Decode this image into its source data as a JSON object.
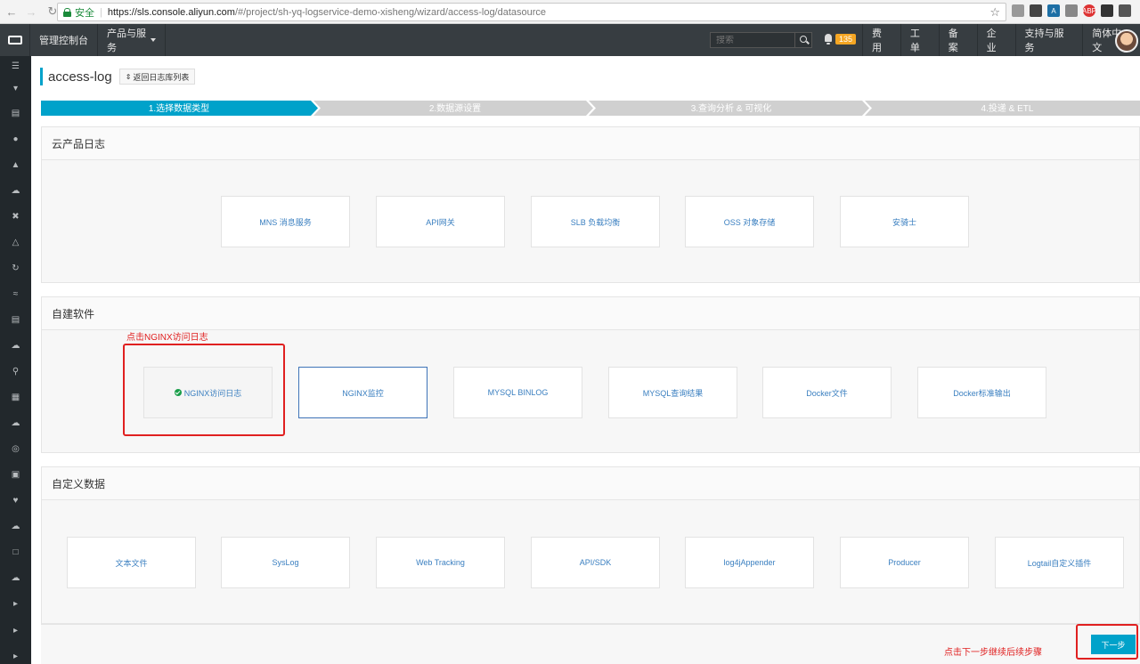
{
  "browser": {
    "secure_label": "安全",
    "url_host": "https://sls.console.aliyun.com",
    "url_path": "/#/project/sh-yq-logservice-demo-xisheng/wizard/access-log/datasource"
  },
  "topnav": {
    "console_label": "管理控制台",
    "products_label": "产品与服务",
    "search_placeholder": "搜索",
    "badge_count": "135",
    "right_items": [
      "费用",
      "工单",
      "备案",
      "企业",
      "支持与服务",
      "简体中文"
    ]
  },
  "page": {
    "title": "access-log",
    "back_label": "返回日志库列表"
  },
  "steps": [
    {
      "label": "1.选择数据类型",
      "active": true
    },
    {
      "label": "2.数据源设置",
      "active": false
    },
    {
      "label": "3.查询分析 & 可视化",
      "active": false
    },
    {
      "label": "4.投递 & ETL",
      "active": false
    }
  ],
  "sections": {
    "cloud": {
      "title": "云产品日志",
      "cards": [
        "MNS 消息服务",
        "API网关",
        "SLB 负载均衡",
        "OSS 对象存储",
        "安骑士"
      ]
    },
    "self_built": {
      "title": "自建软件",
      "cards": [
        "NGINX访问日志",
        "NGINX监控",
        "MYSQL BINLOG",
        "MYSQL查询结果",
        "Docker文件",
        "Docker标准输出"
      ]
    },
    "custom": {
      "title": "自定义数据",
      "cards": [
        "文本文件",
        "SysLog",
        "Web Tracking",
        "API/SDK",
        "log4jAppender",
        "Producer",
        "Logtail自定义插件"
      ]
    }
  },
  "annotations": {
    "click_nginx": "点击NGINX访问日志",
    "click_next": "点击下一步继续后续步骤"
  },
  "next_button": "下一步",
  "colors": {
    "accent": "#00a2ca",
    "annotation": "#e02020",
    "topnav_bg": "#373d41",
    "sidebar_bg": "#22282c"
  }
}
